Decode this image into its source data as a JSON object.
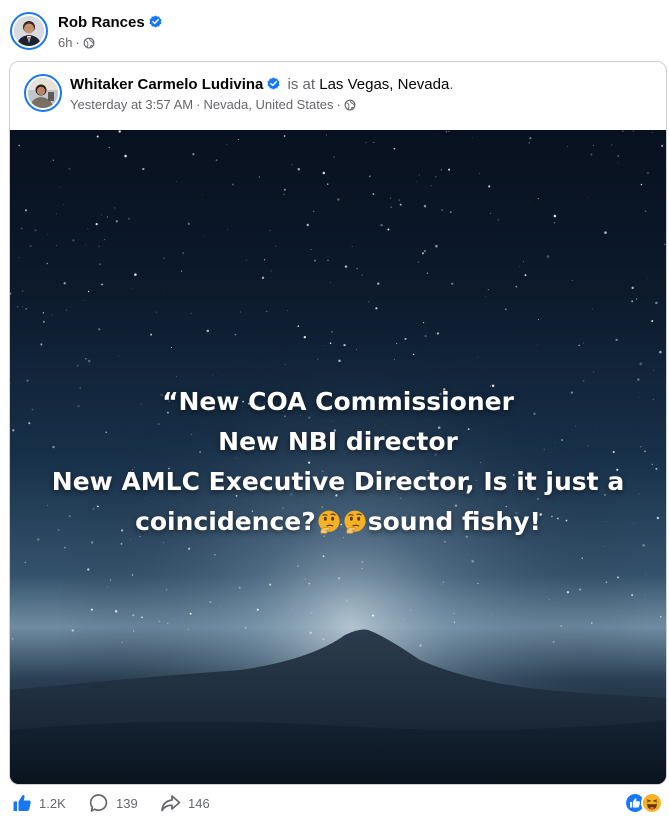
{
  "post": {
    "author_name": "Rob Rances",
    "time": "6h",
    "separator": "·",
    "verified_icon": "verified-badge-icon",
    "privacy_icon": "globe-icon"
  },
  "shared_post": {
    "author_name": "Whitaker Carmelo Ludivina",
    "is_at": "is at",
    "place": "Las Vegas, Nevada",
    "trailing_dot": ".",
    "timestamp": "Yesterday at 3:57 AM",
    "location": "Nevada, United States",
    "separator": "·",
    "privacy_icon": "globe-icon",
    "image_text": {
      "line1": "“New COA Commissioner",
      "line2": "New NBI director",
      "line3": "New AMLC Executive Director, Is it just a",
      "line4_pre": "coincidence?",
      "line4_post": "sound fishy!",
      "emoji_icon": "thinking-face-icon"
    }
  },
  "engagement": {
    "likes": "1.2K",
    "comments": "139",
    "shares": "146",
    "like_icon": "thumbs-up-icon",
    "comment_icon": "comment-bubble-icon",
    "share_icon": "share-arrow-icon",
    "reaction_icons": [
      "like-reaction-icon",
      "haha-reaction-icon"
    ]
  },
  "colors": {
    "accent": "#1877f2",
    "secondary_text": "#65676b",
    "haha": "#f7b125"
  }
}
